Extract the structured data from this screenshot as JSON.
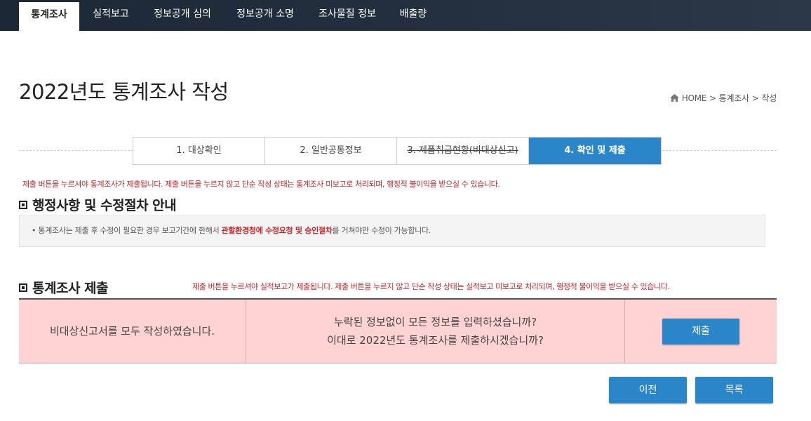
{
  "nav": {
    "items": [
      {
        "label": "통계조사",
        "active": true
      },
      {
        "label": "실적보고",
        "active": false
      },
      {
        "label": "정보공개 심의",
        "active": false
      },
      {
        "label": "정보공개 소명",
        "active": false
      },
      {
        "label": "조사물질 정보",
        "active": false
      },
      {
        "label": "배출량",
        "active": false
      }
    ]
  },
  "page": {
    "title": "2022년도 통계조사 작성"
  },
  "breadcrumb": {
    "home": "HOME",
    "sep1": ">",
    "level1": "통계조사",
    "sep2": ">",
    "level2": "작성"
  },
  "steps": [
    {
      "label": "1. 대상확인",
      "state": "normal"
    },
    {
      "label": "2. 일반공통정보",
      "state": "normal"
    },
    {
      "label": "3. 제품취급현황(비대상신고)",
      "state": "strike"
    },
    {
      "label": "4. 확인 및 제출",
      "state": "active"
    }
  ],
  "warnings": {
    "top": "제출 버튼을 누르셔야 통계조사가 제출됩니다. 제출 버튼을 누르지 않고 단순 작성 상태는 통계조사 미보고로 처리되며, 행정적 불이익을 받으실 수 있습니다.",
    "middle": "제출 버튼을 누르셔야 실적보고가 제출됩니다. 제출 버튼을 누르지 않고 단순 작성 상태는 실적보고 미보고로 처리되며, 행정적 불이익을 받으실 수 있습니다."
  },
  "admin_section": {
    "title": "행정사항 및 수정절차 안내",
    "notice_prefix": "• 통계조사는 제출 후 수정이 필요한 경우 보고기간에 한해서 ",
    "notice_emph": "관할환경청에 수정요청 및 승인절차",
    "notice_suffix": "를 거쳐야만 수정이 가능합니다."
  },
  "submit_section": {
    "title": "통계조사 제출",
    "status_text": "비대상신고서를 모두 작성하였습니다.",
    "confirm_line1": "누락된 정보없이 모든 정보를 입력하셨습니까?",
    "confirm_line2": "이대로 2022년도 통계조사를 제출하시겠습니까?",
    "submit_label": "제출"
  },
  "footer_buttons": {
    "prev_label": "이전",
    "list_label": "목록"
  },
  "colors": {
    "nav_bg": "#1c2836",
    "accent_blue": "#2a86c8",
    "warning_red": "#c0262a",
    "submit_row_bg": "#ffd3d3",
    "notice_bg": "#f4f4f4"
  }
}
